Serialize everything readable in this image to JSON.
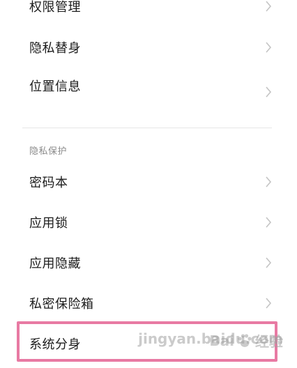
{
  "top_list": [
    {
      "label": "权限管理"
    },
    {
      "label": "隐私替身"
    },
    {
      "label": "位置信息"
    }
  ],
  "privacy_section": {
    "title": "隐私保护",
    "items": [
      {
        "label": "密码本"
      },
      {
        "label": "应用锁"
      },
      {
        "label": "应用隐藏"
      },
      {
        "label": "私密保险箱"
      },
      {
        "label": "系统分身"
      }
    ]
  },
  "watermark": {
    "text": "Bai",
    "suffix": "经验",
    "sub": "jingyan.baidu.com"
  },
  "colors": {
    "highlight": "#e87aa3",
    "chevron": "#c4c4c4",
    "section_title": "#8a8a8a"
  },
  "icons": {
    "chevron": "chevron-right-icon",
    "watermark": "paw-icon"
  }
}
